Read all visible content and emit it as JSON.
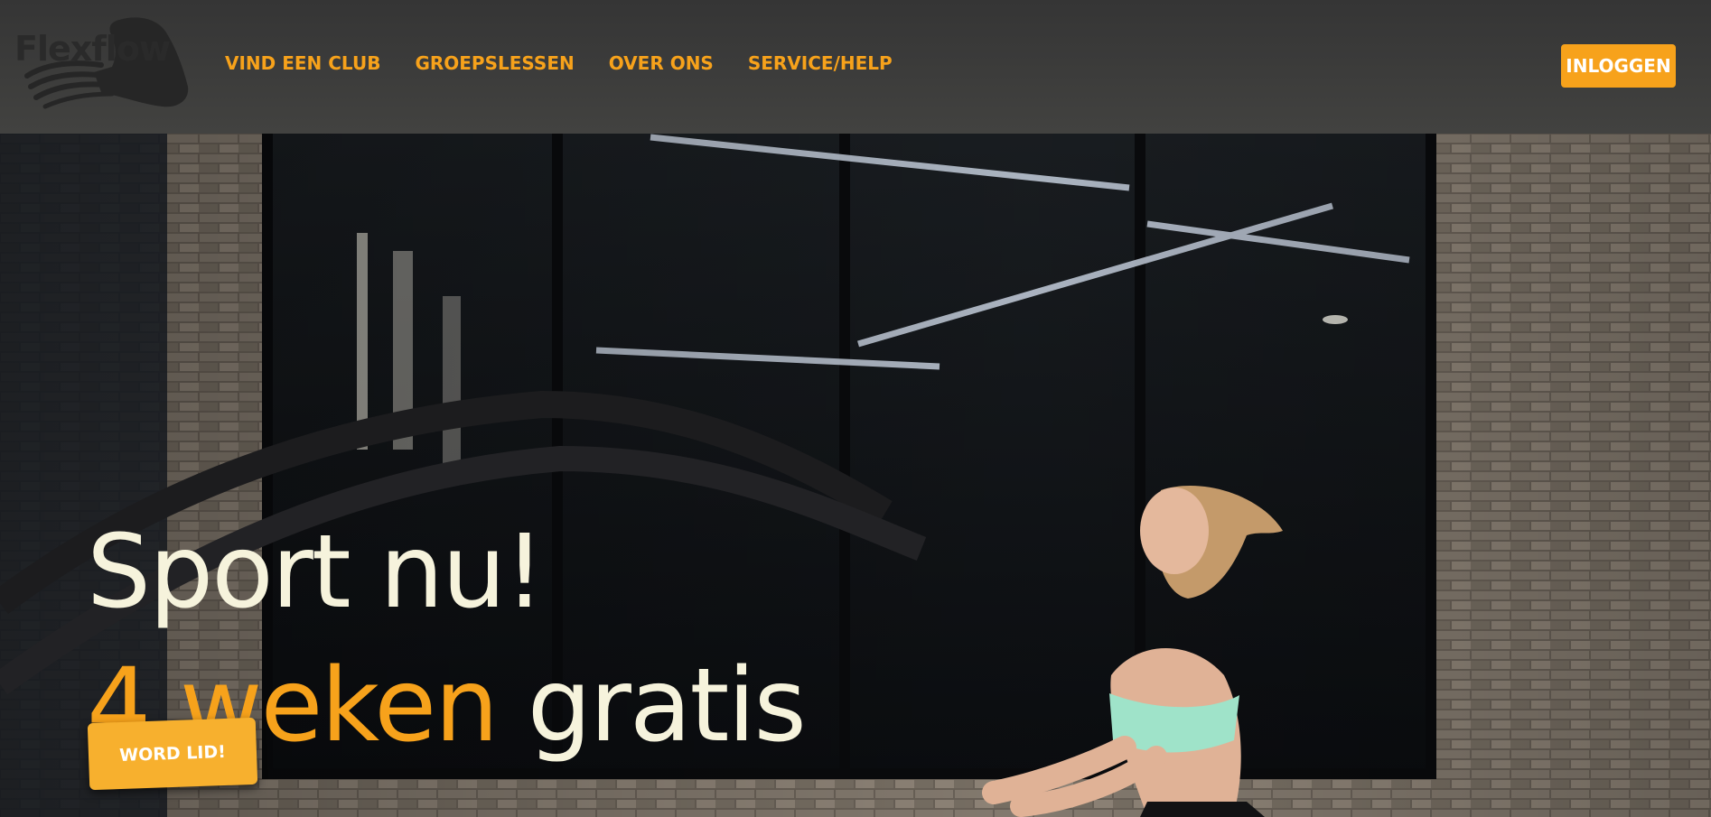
{
  "header": {
    "logo_text": "Flexflow",
    "logo_icon": "flexed-arm-icon",
    "nav": [
      {
        "label": "VIND EEN CLUB"
      },
      {
        "label": "GROEPSLESSEN"
      },
      {
        "label": "OVER ONS"
      },
      {
        "label": "SERVICE/HELP"
      }
    ],
    "login_label": "INLOGGEN"
  },
  "hero": {
    "headline_line1": "Sport nu!",
    "headline_accent": "4 weken",
    "headline_rest": "gratis",
    "cta_label": "WORD LID!",
    "image_subject": "woman training with battle ropes in gym"
  },
  "colors": {
    "accent": "#f7a21b",
    "headline": "#f6f3dc",
    "navbar": "#3d3d3b",
    "cta": "#f7b02e"
  }
}
